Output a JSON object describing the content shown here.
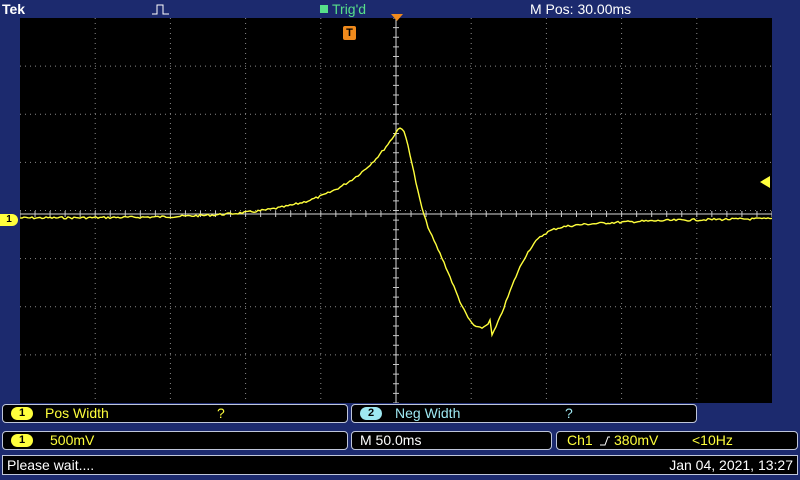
{
  "header": {
    "brand": "Tek",
    "trigger_state": "Trig'd",
    "position": "M Pos: 30.00ms"
  },
  "markers": {
    "channel_marker": "1",
    "trigger_pos_marker": "T"
  },
  "measurements": [
    {
      "channel": "1",
      "label": "Pos Width",
      "value": "?"
    },
    {
      "channel": "2",
      "label": "Neg Width",
      "value": "?"
    }
  ],
  "settings": {
    "channel": "1",
    "volts_per_div": "500mV",
    "timebase": "M 50.0ms",
    "trigger_source": "Ch1",
    "trigger_level": "380mV",
    "frequency": "<10Hz"
  },
  "status": {
    "message": "Please wait....",
    "datetime": "Jan 04, 2021, 13:27"
  },
  "colors": {
    "background": "#1c2a6e",
    "trace": "#ffff3c",
    "grid": "#8a8a8a",
    "trigger_state": "#57e08a",
    "marker_orange": "#f08a1c",
    "channel2": "#9ee8f2"
  }
}
